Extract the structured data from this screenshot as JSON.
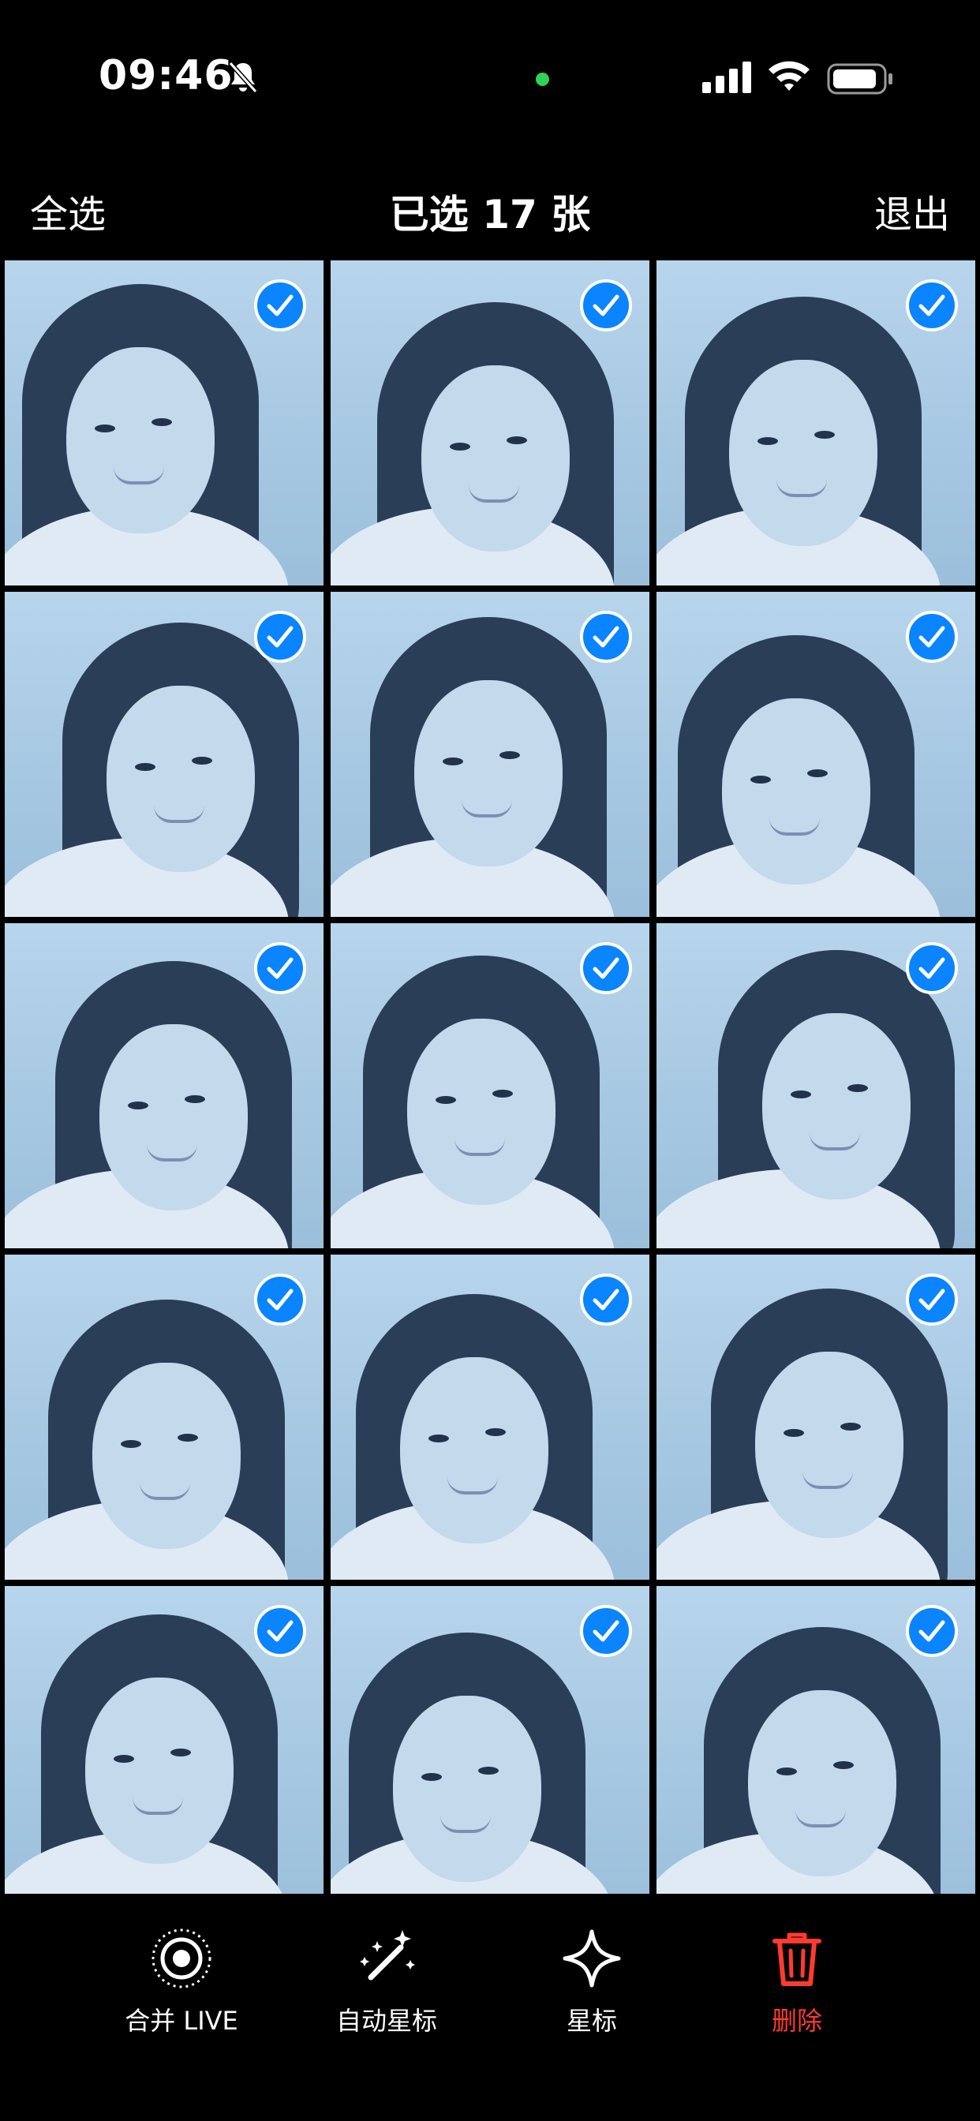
{
  "status_bar": {
    "time": "09:46",
    "icons": [
      "bell-slash-icon",
      "camera-indicator-dot",
      "cellular-signal-icon",
      "wifi-icon",
      "battery-icon"
    ]
  },
  "nav": {
    "select_all": "全选",
    "title": "已选 17 张",
    "exit": "退出"
  },
  "grid": {
    "selected_count": 17,
    "visible_tiles": 15,
    "tiles": [
      {
        "selected": true
      },
      {
        "selected": true
      },
      {
        "selected": true
      },
      {
        "selected": true
      },
      {
        "selected": true
      },
      {
        "selected": true
      },
      {
        "selected": true
      },
      {
        "selected": true
      },
      {
        "selected": true
      },
      {
        "selected": true
      },
      {
        "selected": true
      },
      {
        "selected": true
      },
      {
        "selected": true
      },
      {
        "selected": true
      },
      {
        "selected": true
      }
    ]
  },
  "toolbar": {
    "merge_live": "合并 LIVE",
    "auto_star": "自动星标",
    "star": "星标",
    "delete": "删除",
    "delete_color": "#ff3b30",
    "accent_color": "#0a84ff"
  }
}
